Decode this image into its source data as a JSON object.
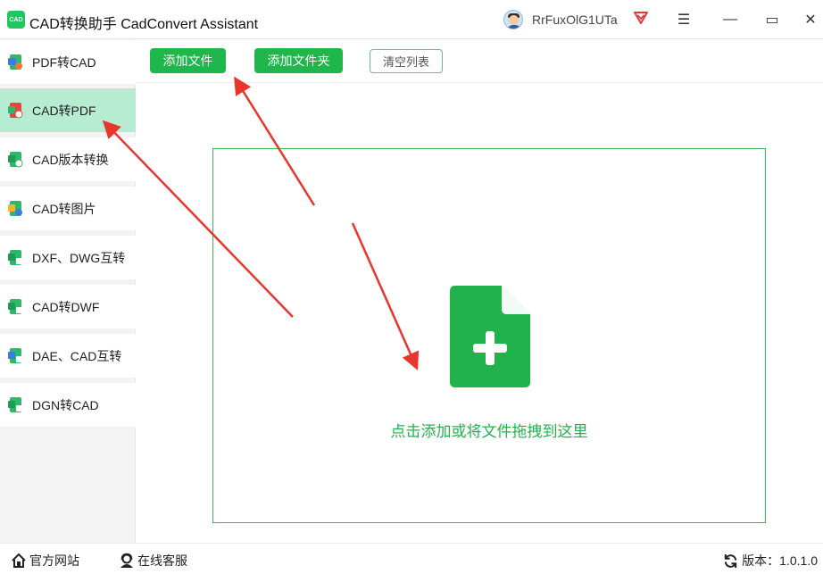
{
  "window": {
    "logo_text": "CAD",
    "title": "CAD转换助手 CadConvert Assistant",
    "username": "RrFuxOlG1UTa",
    "menu_glyph": "☰",
    "minimize_glyph": "—",
    "maximize_glyph": "▭",
    "close_glyph": "✕"
  },
  "sidebar": {
    "items": [
      {
        "label": "PDF转CAD",
        "icon": "pdf-to-cad-icon"
      },
      {
        "label": "CAD转PDF",
        "icon": "cad-to-pdf-icon",
        "active": true
      },
      {
        "label": "CAD版本转换",
        "icon": "cad-version-icon"
      },
      {
        "label": "CAD转图片",
        "icon": "cad-to-image-icon"
      },
      {
        "label": "DXF、DWG互转",
        "icon": "dxf-dwg-icon"
      },
      {
        "label": "CAD转DWF",
        "icon": "cad-to-dwf-icon"
      },
      {
        "label": "DAE、CAD互转",
        "icon": "dae-cad-icon"
      },
      {
        "label": "DGN转CAD",
        "icon": "dgn-to-cad-icon"
      }
    ]
  },
  "toolbar": {
    "add_file": "添加文件",
    "add_folder": "添加文件夹",
    "clear_list": "清空列表"
  },
  "dropzone": {
    "hint": "点击添加或将文件拖拽到这里"
  },
  "statusbar": {
    "official_site": "官方网站",
    "online_support": "在线客服",
    "version": "版本：1.0.1.0"
  },
  "colors": {
    "accent": "#1fb64b",
    "active_item": "#b5ecd2",
    "arrow": "#e8362c"
  }
}
